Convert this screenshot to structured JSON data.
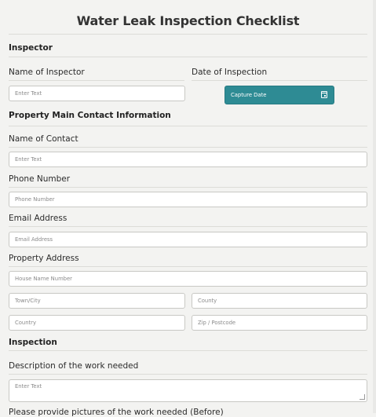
{
  "form": {
    "title": "Water Leak Inspection Checklist",
    "sections": {
      "inspector": "Inspector",
      "property": "Property Main Contact Information",
      "inspection": "Inspection"
    },
    "inspector": {
      "name_label": "Name of Inspector",
      "name_placeholder": "Enter Text",
      "date_label": "Date of Inspection",
      "date_button": "Capture Date"
    },
    "contact": {
      "name_label": "Name of Contact",
      "name_placeholder": "Enter Text",
      "phone_label": "Phone Number",
      "phone_placeholder": "Phone Number",
      "email_label": "Email Address",
      "email_placeholder": "Email Address",
      "address_label": "Property Address",
      "house_placeholder": "House Name Number",
      "town_placeholder": "Town/City",
      "county_placeholder": "County",
      "country_placeholder": "Country",
      "zip_placeholder": "Zip / Postcode"
    },
    "inspection": {
      "description_label": "Description of the work needed",
      "description_placeholder": "Enter Text",
      "next_label_partial": "Please provide pictures of the work needed (Before)"
    }
  },
  "colors": {
    "accent": "#2e8b94",
    "background": "#f3f3f1"
  },
  "icons": {
    "date_button_icon": "calendar-icon"
  }
}
